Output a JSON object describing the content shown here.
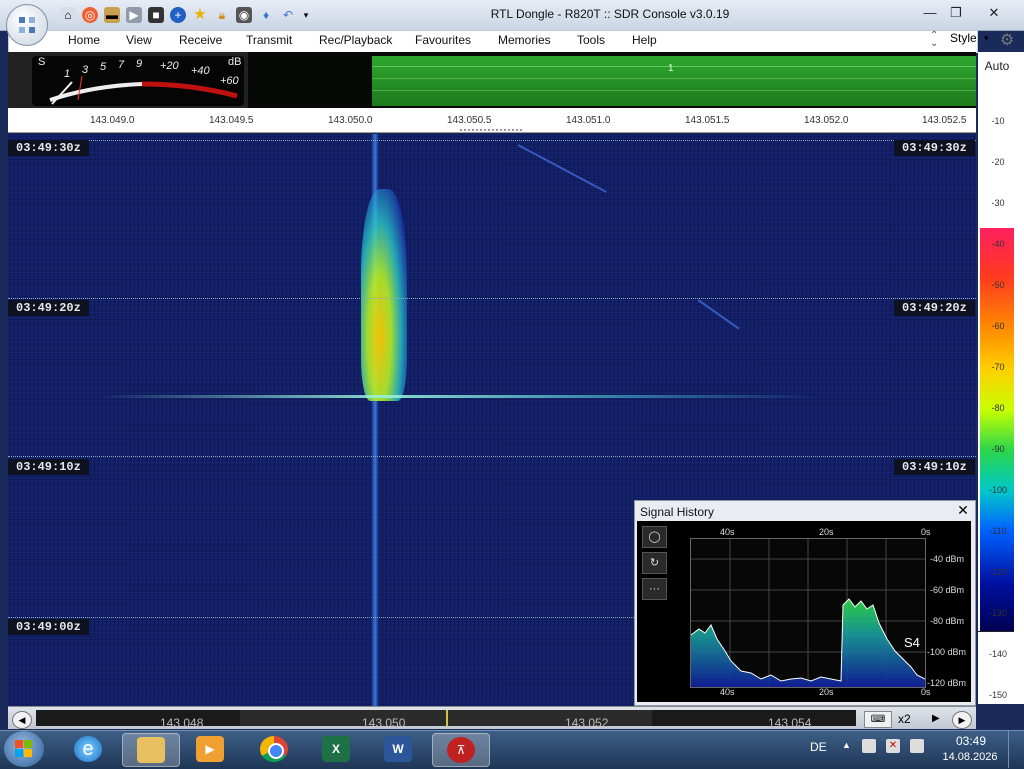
{
  "window": {
    "title": "RTL Dongle - R820T :: SDR Console v3.0.19",
    "minimize": "—",
    "restore": "❐",
    "close": "✕"
  },
  "menu": {
    "items": [
      "Home",
      "View",
      "Receive",
      "Transmit",
      "Rec/Playback",
      "Favourites",
      "Memories",
      "Tools",
      "Help"
    ],
    "style_label": "Style"
  },
  "smeter": {
    "s_label": "S",
    "db_label": "dB",
    "labels": [
      "1",
      "3",
      "5",
      "7",
      "9",
      "+20",
      "+40",
      "+60"
    ]
  },
  "spectrum": {
    "passband_label": "1"
  },
  "frequency_ruler": [
    "143.049.0",
    "143.049.5",
    "143.050.0",
    "143.050.5",
    "143.051.0",
    "143.051.5",
    "143.052.0",
    "143.052.5"
  ],
  "scale": {
    "auto_label": "Auto",
    "values": [
      "-10",
      "-20",
      "-30",
      "-40",
      "-50",
      "-60",
      "-70",
      "-80",
      "-90",
      "-100",
      "-110",
      "-120",
      "-130",
      "-140",
      "-150"
    ]
  },
  "waterfall": {
    "timestamps": [
      "03:49:30z",
      "03:49:20z",
      "03:49:10z",
      "03:49:00z"
    ]
  },
  "signal_history": {
    "title": "Signal History",
    "close": "✕",
    "buttons": [
      "◯",
      "↻",
      "···"
    ],
    "time_top": [
      "40s",
      "20s",
      "0s"
    ],
    "time_bottom": [
      "40s",
      "20s",
      "0s"
    ],
    "dbm_labels": [
      "-40 dBm",
      "-60 dBm",
      "-80 dBm",
      "-100 dBm",
      "-120 dBm"
    ],
    "s_reading": "S4"
  },
  "bottom_bar": {
    "freqs": [
      "143.048",
      "143.050",
      "143.052",
      "143.054"
    ],
    "zoom": "x2"
  },
  "taskbar": {
    "language": "DE",
    "time": "03:49",
    "date": "14.08.2026"
  },
  "colors": {
    "waterfall_bg": "#0b1548",
    "passband": "#2fa82f",
    "taskbar": "#2a4670"
  }
}
